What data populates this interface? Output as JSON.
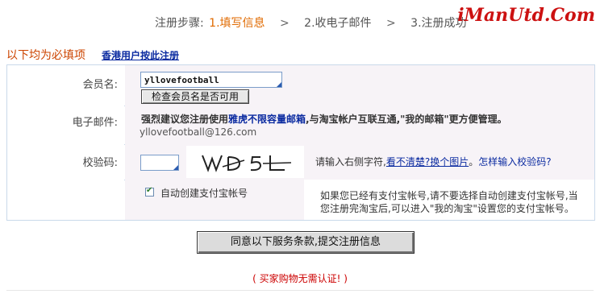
{
  "steps": {
    "prefix": "注册步骤:",
    "step1": "1.填写信息",
    "arrow": ">",
    "step2": "2.收电子邮件",
    "step3": "3.注册成功"
  },
  "watermark": "iManUtd.Com",
  "required_note": "以下均为必填项",
  "hk_link": "香港用户按此注册",
  "member": {
    "label": "会员名:",
    "value": "yllovefootball",
    "check_button": "检查会员名是否可用"
  },
  "email": {
    "label": "电子邮件:",
    "note_pre": "强烈建议您注册使用",
    "note_highlight": "雅虎不限容量邮箱",
    "note_post": ",与淘宝帐户互联互通,\"我的邮箱\"更方便管理。",
    "value": "yllovefootball@126.com"
  },
  "captcha": {
    "label": "校验码:",
    "image_text": "WD5L",
    "hint_pre": "请输入右侧字符,",
    "hint_link": "看不清楚?换个图片",
    "hint_sep": "。",
    "hint_help": "怎样输入校验码?"
  },
  "alipay": {
    "checkbox_label": "自动创建支付宝帐号",
    "note_line1": "如果您已经有支付宝帐号,请不要选择自动创建支付宝帐号,当",
    "note_line2": "您注册完淘宝后,可以进入\"我的淘宝\"设置您的支付宝帐号。"
  },
  "submit_label": "同意以下服务条款,提交注册信息",
  "no_cert_note": "( 买家购物无需认证! )",
  "colors": {
    "active_step": "#e06a00",
    "link": "#0a2aa0",
    "accent_red": "#cc0000",
    "row_bg": "#f7f3f7",
    "border": "#c9d9ea"
  }
}
